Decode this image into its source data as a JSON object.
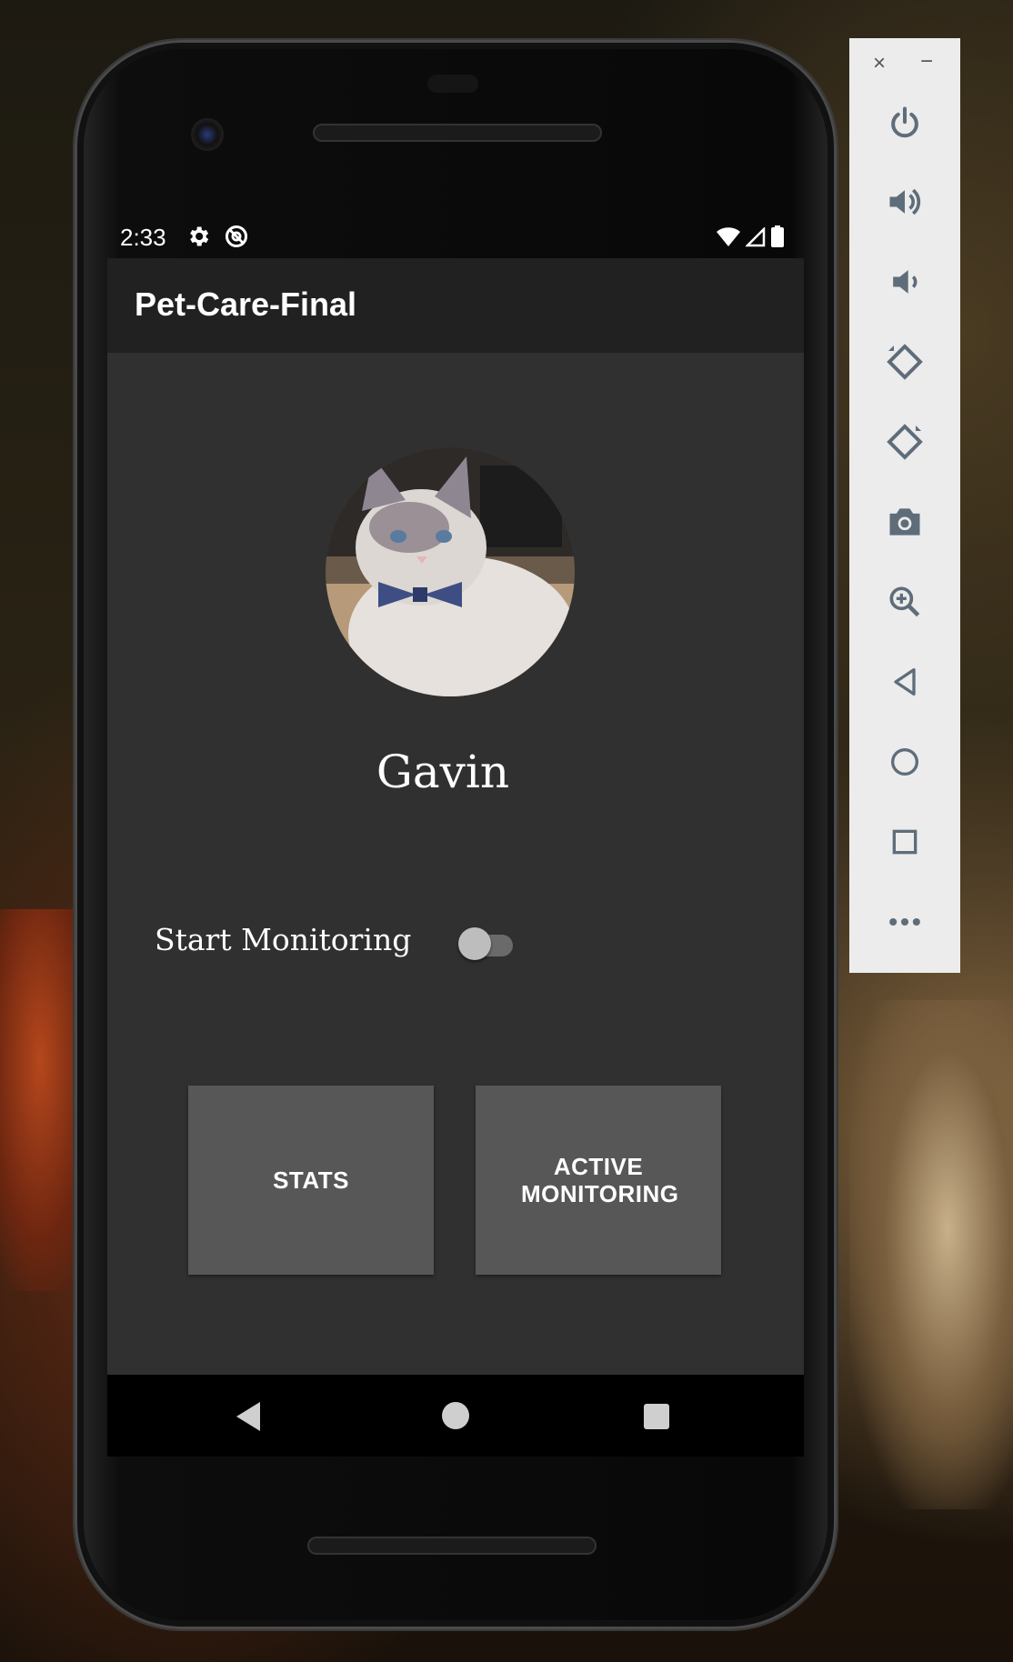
{
  "status_bar": {
    "time": "2:33"
  },
  "app_bar": {
    "title": "Pet-Care-Final"
  },
  "profile": {
    "name": "Gavin"
  },
  "monitoring": {
    "label": "Start Monitoring",
    "enabled": false
  },
  "buttons": {
    "stats": "STATS",
    "active_monitoring": "ACTIVE MONITORING"
  },
  "emulator_controls": {
    "window": {
      "close": "×",
      "minimize": "−"
    },
    "items": [
      "power-icon",
      "volume-up-icon",
      "volume-down-icon",
      "rotate-left-icon",
      "rotate-right-icon",
      "camera-icon",
      "zoom-icon",
      "back-icon",
      "home-icon",
      "overview-icon",
      "more-icon"
    ]
  },
  "colors": {
    "app_bar": "#212121",
    "content": "#303030",
    "button": "#575757",
    "sidebar": "#ececec"
  }
}
